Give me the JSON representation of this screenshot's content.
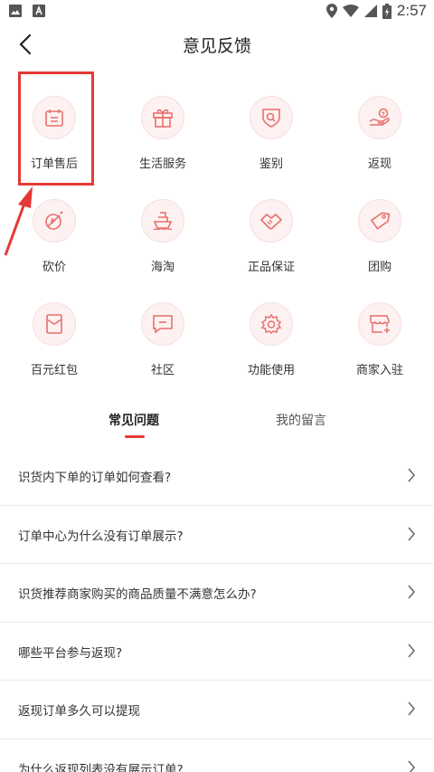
{
  "status_bar": {
    "time": "2:57"
  },
  "header": {
    "title": "意见反馈"
  },
  "categories": [
    {
      "label": "订单售后",
      "icon": "calendar-icon"
    },
    {
      "label": "生活服务",
      "icon": "gift-icon"
    },
    {
      "label": "鉴别",
      "icon": "shield-search-icon"
    },
    {
      "label": "返现",
      "icon": "hand-coin-icon"
    },
    {
      "label": "砍价",
      "icon": "bargain-icon"
    },
    {
      "label": "海淘",
      "icon": "ship-icon"
    },
    {
      "label": "正品保证",
      "icon": "handshake-icon"
    },
    {
      "label": "团购",
      "icon": "tag-icon"
    },
    {
      "label": "百元红包",
      "icon": "red-envelope-icon"
    },
    {
      "label": "社区",
      "icon": "chat-icon"
    },
    {
      "label": "功能使用",
      "icon": "gear-icon"
    },
    {
      "label": "商家入驻",
      "icon": "store-icon"
    }
  ],
  "tabs": [
    {
      "label": "常见问题",
      "active": true
    },
    {
      "label": "我的留言",
      "active": false
    }
  ],
  "faq": [
    "识货内下单的订单如何查看?",
    "订单中心为什么没有订单展示?",
    "识货推荐商家购买的商品质量不满意怎么办?",
    "哪些平台参与返现?",
    "返现订单多久可以提现",
    "为什么返现列表没有展示订单?"
  ],
  "colors": {
    "accent": "#e53935",
    "icon_tint": "#e8706c",
    "circle_bg": "#fdf1f1"
  }
}
